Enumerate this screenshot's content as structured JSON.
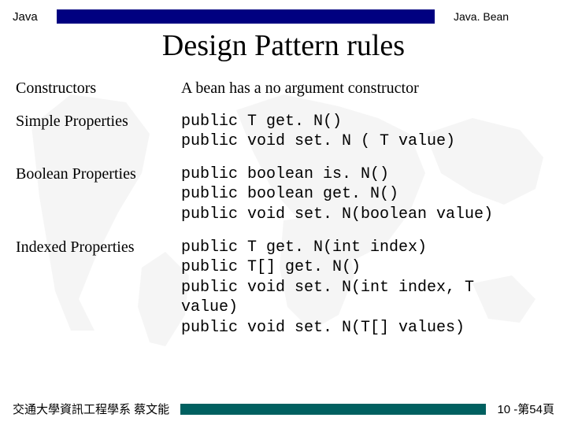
{
  "header": {
    "left": "Java",
    "right": "Java. Bean"
  },
  "title": "Design Pattern rules",
  "rules": [
    {
      "label": "Constructors",
      "desc": "A bean has a no argument constructor",
      "is_code": false
    },
    {
      "label": "Simple Properties",
      "desc": "public T get. N()\npublic void set. N ( T value)",
      "is_code": true
    },
    {
      "label": "Boolean Properties",
      "desc": "public boolean is. N()\npublic boolean get. N()\npublic void set. N(boolean value)",
      "is_code": true
    },
    {
      "label": "Indexed Properties",
      "desc": "public T get. N(int index)\npublic T[] get. N()\npublic void set. N(int index, T\nvalue)\npublic void set. N(T[] values)",
      "is_code": true
    }
  ],
  "footer": {
    "left": "交通大學資訊工程學系 蔡文能",
    "right": "10 -第54頁"
  }
}
